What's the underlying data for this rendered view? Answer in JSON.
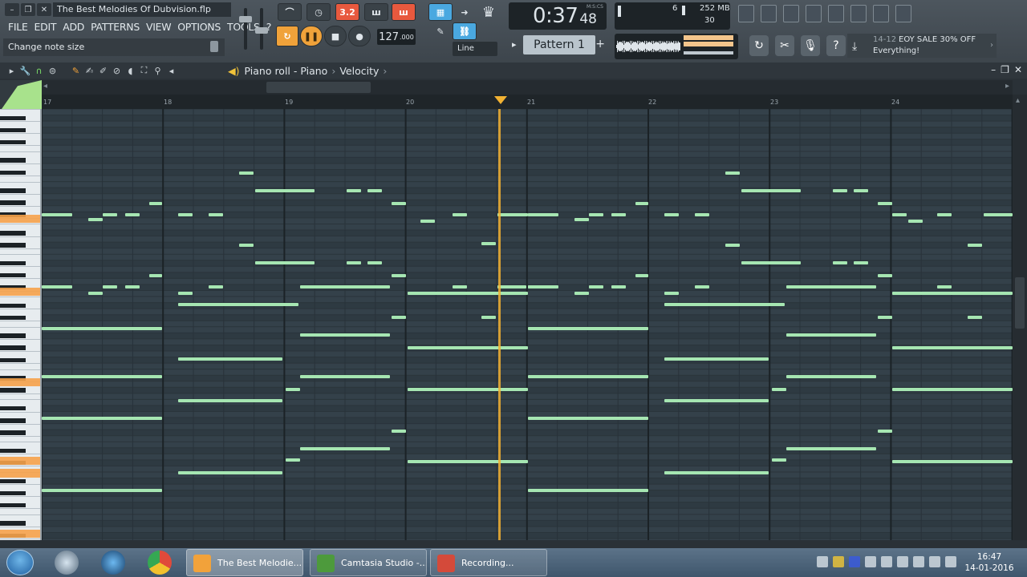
{
  "window": {
    "title": "The Best Melodies Of Dubvision.flp"
  },
  "menubar": [
    "FILE",
    "EDIT",
    "ADD",
    "PATTERNS",
    "VIEW",
    "OPTIONS",
    "TOOLS",
    "?"
  ],
  "hint": "Change note size",
  "transport": {
    "tempo": "127",
    "tempo_decimals": ".000",
    "time_main": "0:37",
    "time_sub": "48",
    "time_unit": "M:S:CS",
    "snap_mode": "Line"
  },
  "pattern": {
    "name": "Pattern 1"
  },
  "cpu": {
    "voices": "6",
    "ram": "252 MB",
    "poly": "30"
  },
  "news": {
    "date": "14-12",
    "headline": "EOY SALE 30% OFF",
    "subline": "Everything!"
  },
  "piano_roll": {
    "breadcrumb": [
      "Piano roll - Piano",
      "Velocity"
    ],
    "ruler_bars": [
      "17",
      "18",
      "19",
      "20",
      "21",
      "22",
      "23",
      "24"
    ],
    "playhead_bar": 20.77
  },
  "taskbar": {
    "tasks": [
      "The Best Melodie...",
      "Camtasia Studio -...",
      "Recording..."
    ],
    "time": "16:47",
    "date": "14-01-2016"
  },
  "colors": {
    "note": "#a6e6b2",
    "grid_bg": "#34414a",
    "playhead": "#f2b233",
    "accent_key": "#f6a24a"
  }
}
